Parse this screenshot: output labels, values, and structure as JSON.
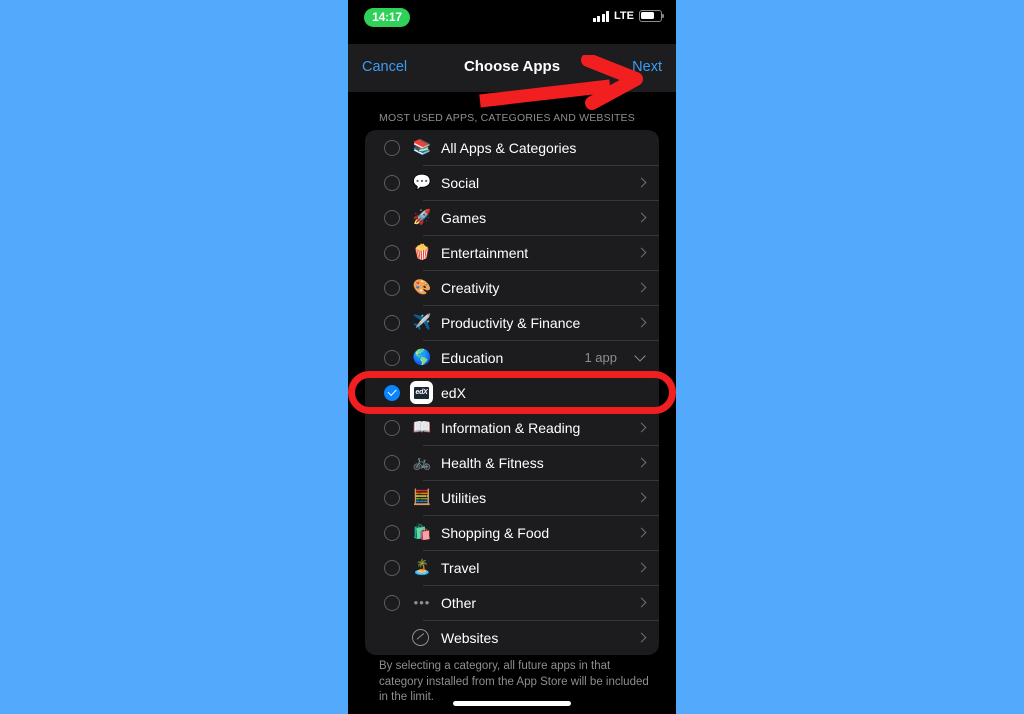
{
  "background_color": "#53aafd",
  "status_bar": {
    "time": "14:17",
    "time_pill_color": "#30d158",
    "carrier_tech": "LTE",
    "signal_icon": "signal-bars-icon",
    "battery_icon": "battery-icon"
  },
  "nav_bar": {
    "cancel_label": "Cancel",
    "title": "Choose Apps",
    "next_label": "Next",
    "tint_color": "#3b9cf4"
  },
  "section": {
    "header": "MOST USED APPS, CATEGORIES AND WEBSITES"
  },
  "rows": [
    {
      "label": "All Apps & Categories",
      "icon": "stacked-layers-icon",
      "glyph": "📚",
      "selected": false,
      "has_chevron": false,
      "value": ""
    },
    {
      "label": "Social",
      "icon": "speech-bubbles-icon",
      "glyph": "💬",
      "selected": false,
      "has_chevron": true,
      "value": ""
    },
    {
      "label": "Games",
      "icon": "rocket-icon",
      "glyph": "🚀",
      "selected": false,
      "has_chevron": true,
      "value": ""
    },
    {
      "label": "Entertainment",
      "icon": "popcorn-icon",
      "glyph": "🍿",
      "selected": false,
      "has_chevron": true,
      "value": ""
    },
    {
      "label": "Creativity",
      "icon": "artist-palette-icon",
      "glyph": "🎨",
      "selected": false,
      "has_chevron": true,
      "value": ""
    },
    {
      "label": "Productivity & Finance",
      "icon": "paper-plane-icon",
      "glyph": "✈️",
      "selected": false,
      "has_chevron": true,
      "value": ""
    },
    {
      "label": "Education",
      "icon": "globe-icon",
      "glyph": "🌎",
      "selected": false,
      "has_chevron": false,
      "expanded": true,
      "value": "1 app"
    },
    {
      "label": "edX",
      "icon": "edx-app-icon",
      "glyph": "edX",
      "selected": true,
      "has_chevron": false,
      "value": "",
      "is_app": true,
      "highlighted": true
    },
    {
      "label": "Information & Reading",
      "icon": "open-book-icon",
      "glyph": "📖",
      "selected": false,
      "has_chevron": true,
      "value": ""
    },
    {
      "label": "Health & Fitness",
      "icon": "bicycle-icon",
      "glyph": "🚲",
      "selected": false,
      "has_chevron": true,
      "value": ""
    },
    {
      "label": "Utilities",
      "icon": "calculator-icon",
      "glyph": "🧮",
      "selected": false,
      "has_chevron": true,
      "value": ""
    },
    {
      "label": "Shopping & Food",
      "icon": "shopping-bag-icon",
      "glyph": "🛍️",
      "selected": false,
      "has_chevron": true,
      "value": ""
    },
    {
      "label": "Travel",
      "icon": "island-icon",
      "glyph": "🏝️",
      "selected": false,
      "has_chevron": true,
      "value": ""
    },
    {
      "label": "Other",
      "icon": "ellipsis-icon",
      "glyph": "•••",
      "selected": false,
      "has_chevron": true,
      "value": ""
    },
    {
      "label": "Websites",
      "icon": "compass-icon",
      "glyph": "",
      "selected": null,
      "has_chevron": true,
      "value": ""
    }
  ],
  "footer": {
    "note": "By selecting a category, all future apps in that category installed from the App Store will be included in the limit."
  },
  "annotations": {
    "arrow": {
      "name": "red-arrow-annotation",
      "color": "#f21f20",
      "points_to": "Next"
    },
    "highlight": {
      "name": "red-highlight-box-annotation",
      "color": "#f21f20",
      "surrounds": "edX"
    }
  },
  "selection": {
    "checked_color": "#0a84ff",
    "checked_item": "edX"
  }
}
